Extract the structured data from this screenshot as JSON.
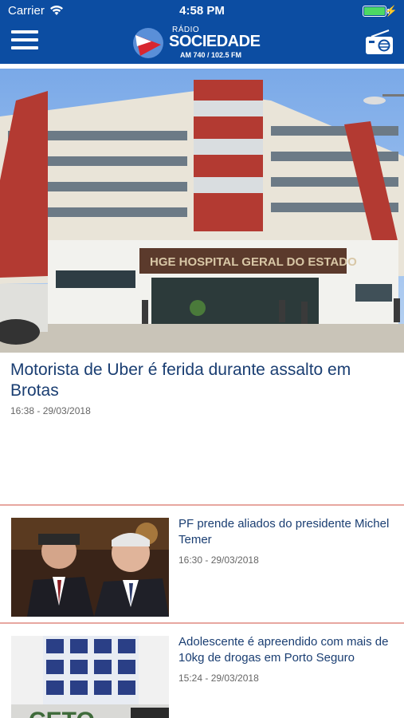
{
  "status_bar": {
    "carrier": "Carrier",
    "time": "4:58 PM",
    "battery_level": 1.0
  },
  "header": {
    "brand_small": "RÁDIO",
    "brand_name": "SOCIEDADE",
    "brand_freq": "AM 740 / 102.5 FM",
    "bg_color": "#0c4da2"
  },
  "featured": {
    "image_icon": "hospital-building-photo",
    "image_sign": "HGE HOSPITAL GERAL DO ESTADO",
    "title": "Motorista de Uber é ferida durante assalto em Brotas",
    "timestamp": "16:38 - 29/03/2018"
  },
  "news": [
    {
      "image_icon": "politicians-photo",
      "title": "PF prende aliados do presidente Michel Temer",
      "timestamp": "16:30 - 29/03/2018"
    },
    {
      "image_icon": "police-seizure-photo",
      "title": "Adolescente é apreendido com mais de 10kg de drogas em Porto Seguro",
      "timestamp": "15:24 - 29/03/2018",
      "image_text": "CETO"
    }
  ],
  "colors": {
    "title": "#1a3e72",
    "divider": "#e7a7a0",
    "brand_red": "#d8262f"
  }
}
